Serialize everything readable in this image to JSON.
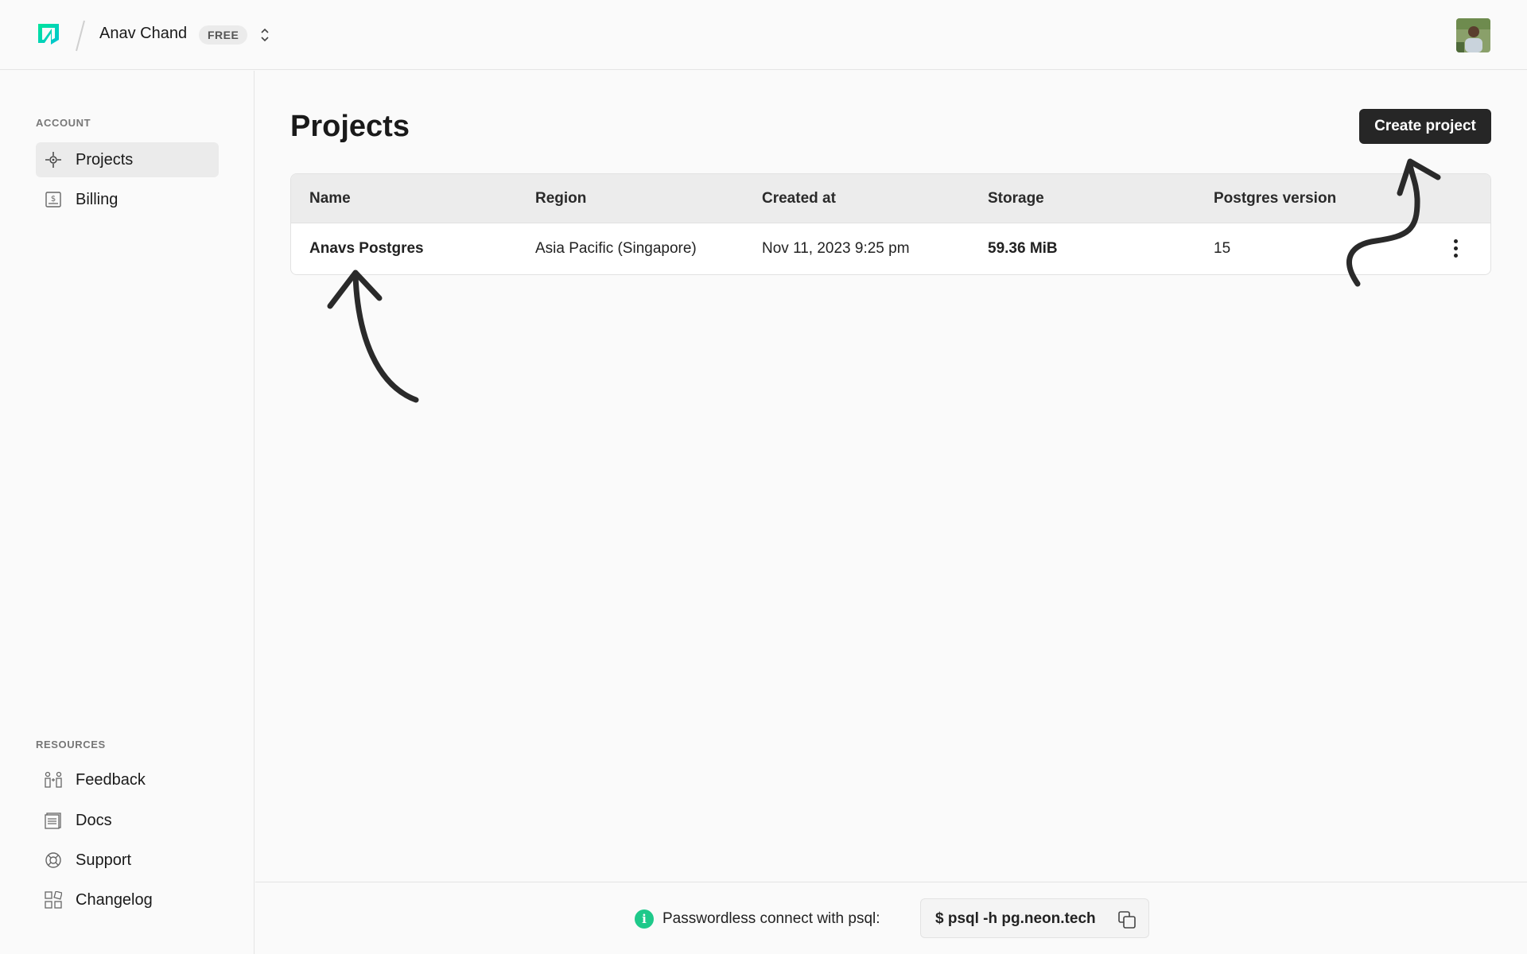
{
  "header": {
    "org_name": "Anav Chand",
    "plan_badge": "FREE",
    "logo_icon": "neon-logo",
    "switcher_icon": "chevron-up-down-icon",
    "avatar_icon": "user-avatar"
  },
  "sidebar": {
    "account_label": "ACCOUNT",
    "account_items": [
      {
        "label": "Projects",
        "icon": "projects-icon",
        "active": true
      },
      {
        "label": "Billing",
        "icon": "billing-icon",
        "active": false
      }
    ],
    "resources_label": "RESOURCES",
    "resource_items": [
      {
        "label": "Feedback",
        "icon": "feedback-icon"
      },
      {
        "label": "Docs",
        "icon": "docs-icon"
      },
      {
        "label": "Support",
        "icon": "support-icon"
      },
      {
        "label": "Changelog",
        "icon": "changelog-icon"
      }
    ]
  },
  "main": {
    "title": "Projects",
    "create_button": "Create project",
    "table": {
      "columns": [
        "Name",
        "Region",
        "Created at",
        "Storage",
        "Postgres version"
      ],
      "rows": [
        {
          "name": "Anavs Postgres",
          "region": "Asia Pacific (Singapore)",
          "created_at": "Nov 11, 2023 9:25 pm",
          "storage": "59.36 MiB",
          "postgres_version": "15"
        }
      ]
    }
  },
  "footer": {
    "info_text": "Passwordless connect with psql:",
    "command": "$ psql -h pg.neon.tech",
    "copy_icon": "copy-icon"
  },
  "colors": {
    "accent": "#1ec98a",
    "button_bg": "#262626",
    "background": "#fafafa"
  }
}
